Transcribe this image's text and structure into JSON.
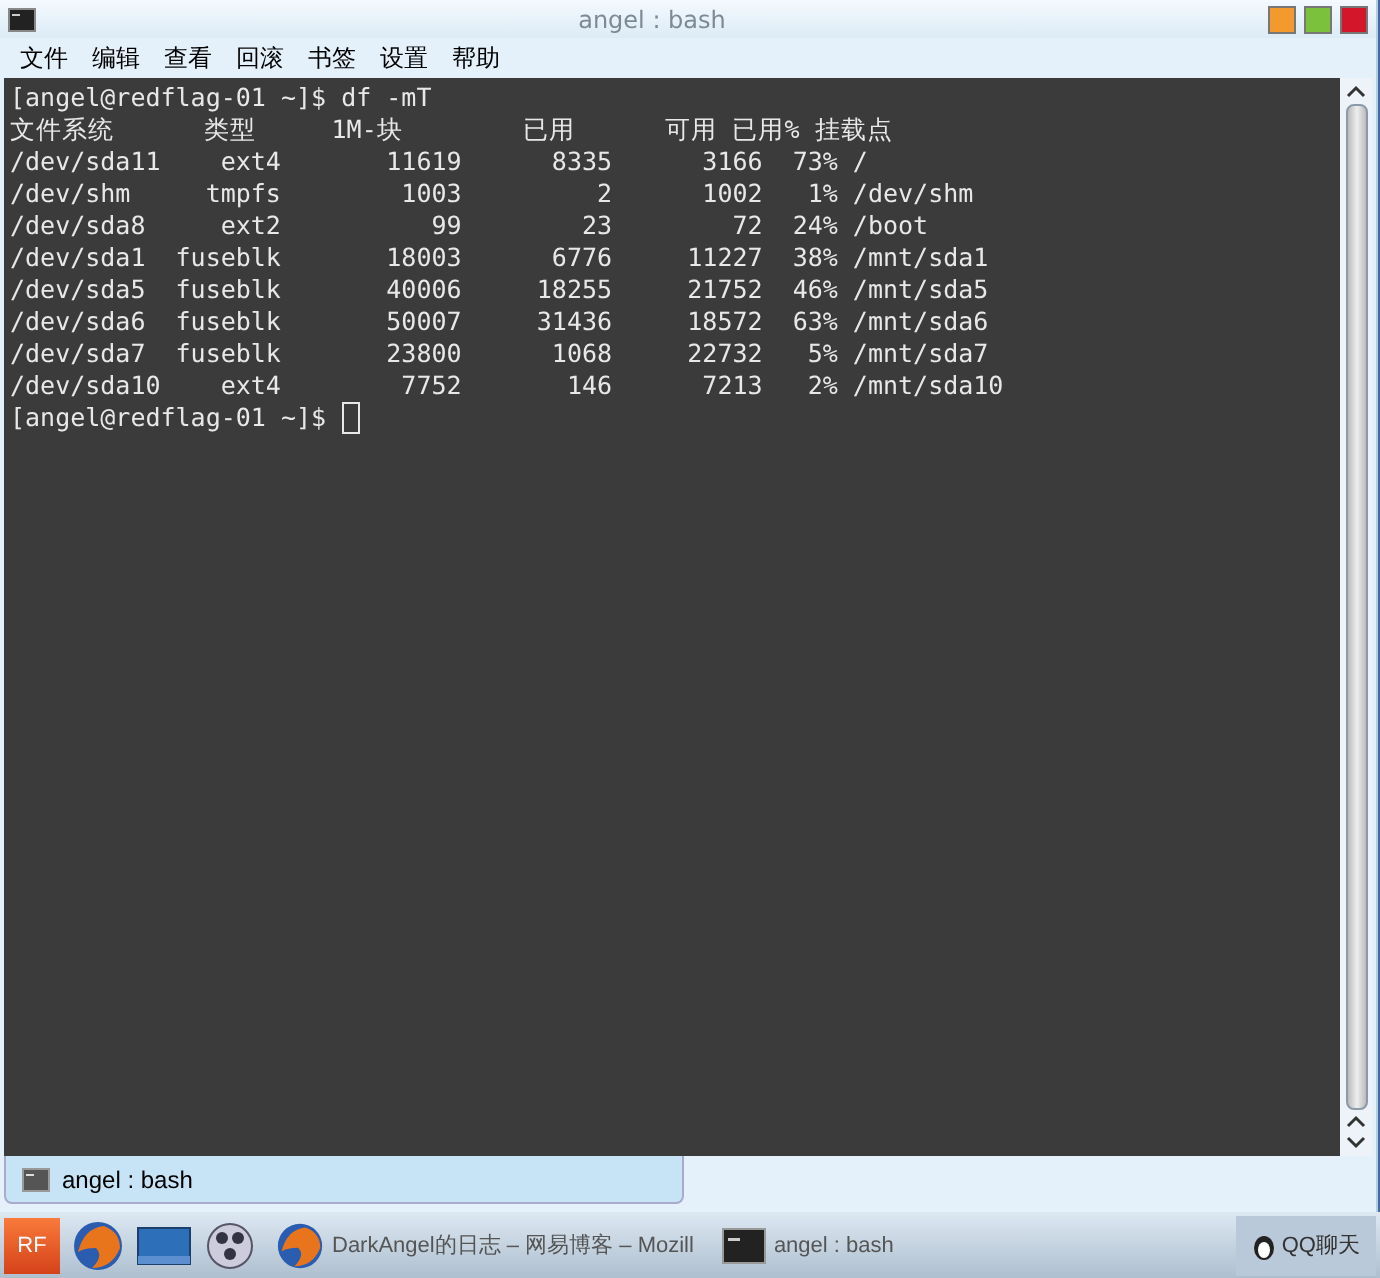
{
  "window": {
    "title": "angel : bash"
  },
  "menu": [
    "文件",
    "编辑",
    "查看",
    "回滚",
    "书签",
    "设置",
    "帮助"
  ],
  "terminal": {
    "lines": [
      "[angel@redflag-01 ~]$ df -mT",
      "文件系统      类型     1M-块        已用      可用 已用% 挂载点",
      "/dev/sda11    ext4       11619      8335      3166  73% /",
      "/dev/shm     tmpfs        1003         2      1002   1% /dev/shm",
      "/dev/sda8     ext2          99        23        72  24% /boot",
      "/dev/sda1  fuseblk       18003      6776     11227  38% /mnt/sda1",
      "/dev/sda5  fuseblk       40006     18255     21752  46% /mnt/sda5",
      "/dev/sda6  fuseblk       50007     31436     18572  63% /mnt/sda6",
      "/dev/sda7  fuseblk       23800      1068     22732   5% /mnt/sda7",
      "/dev/sda10    ext4        7752       146      7213   2% /mnt/sda10"
    ],
    "prompt": "[angel@redflag-01 ~]$"
  },
  "tabs": [
    {
      "label": "angel : bash",
      "selected": true
    }
  ],
  "taskbar": {
    "items": [
      {
        "kind": "start",
        "label": "RF"
      },
      {
        "kind": "browser"
      },
      {
        "kind": "desktop"
      },
      {
        "kind": "media"
      },
      {
        "kind": "window",
        "label": "DarkAngel的日志 – 网易博客 – Mozill",
        "selected": false
      },
      {
        "kind": "terminal",
        "label": "angel : bash",
        "selected": false
      }
    ],
    "tray": "QQ聊天"
  }
}
